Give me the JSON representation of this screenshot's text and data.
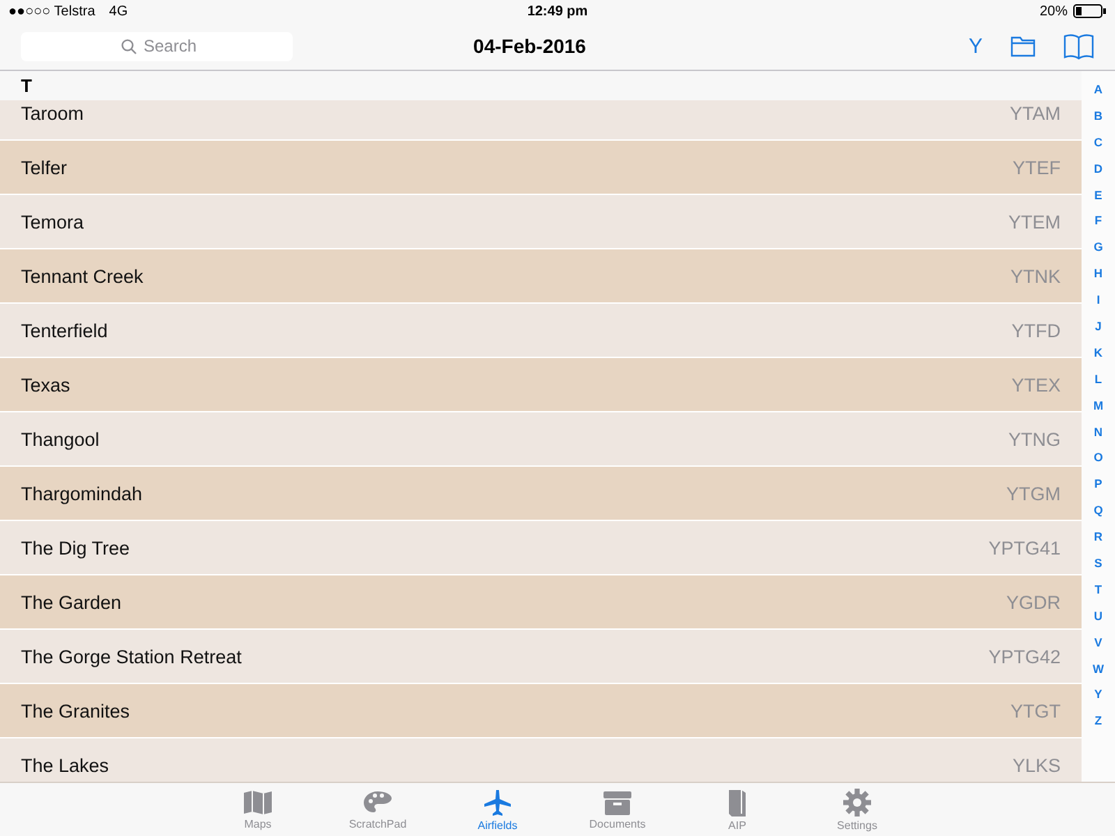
{
  "status_bar": {
    "carrier": "●●○○○ Telstra",
    "network": "4G",
    "time": "12:49 pm",
    "battery": "20%"
  },
  "nav": {
    "search": {
      "placeholder": "Search"
    },
    "title": "04-Feb-2016",
    "letter_button": "Y"
  },
  "section": {
    "header": "T"
  },
  "rows": [
    {
      "name": "Taroom",
      "code": "YTAM"
    },
    {
      "name": "Telfer",
      "code": "YTEF"
    },
    {
      "name": "Temora",
      "code": "YTEM"
    },
    {
      "name": "Tennant Creek",
      "code": "YTNK"
    },
    {
      "name": "Tenterfield",
      "code": "YTFD"
    },
    {
      "name": "Texas",
      "code": "YTEX"
    },
    {
      "name": "Thangool",
      "code": "YTNG"
    },
    {
      "name": "Thargomindah",
      "code": "YTGM"
    },
    {
      "name": "The Dig Tree",
      "code": "YPTG41"
    },
    {
      "name": "The Garden",
      "code": "YGDR"
    },
    {
      "name": "The Gorge Station Retreat",
      "code": "YPTG42"
    },
    {
      "name": "The Granites",
      "code": "YTGT"
    },
    {
      "name": "The Lakes",
      "code": "YLKS"
    }
  ],
  "index": [
    "A",
    "B",
    "C",
    "D",
    "E",
    "F",
    "G",
    "H",
    "I",
    "J",
    "K",
    "L",
    "M",
    "N",
    "O",
    "P",
    "Q",
    "R",
    "S",
    "T",
    "U",
    "V",
    "W",
    "Y",
    "Z"
  ],
  "tabs": [
    {
      "label": "Maps",
      "kind": "map",
      "selected": false
    },
    {
      "label": "ScratchPad",
      "kind": "palette",
      "selected": false
    },
    {
      "label": "Airfields",
      "kind": "plane",
      "selected": true
    },
    {
      "label": "Documents",
      "kind": "box",
      "selected": false
    },
    {
      "label": "AIP",
      "kind": "book",
      "selected": false
    },
    {
      "label": "Settings",
      "kind": "gear",
      "selected": false
    }
  ]
}
